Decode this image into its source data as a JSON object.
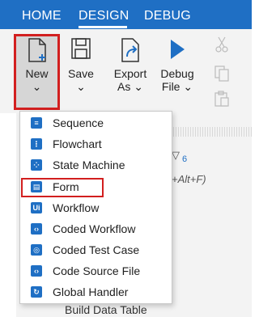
{
  "tabs": [
    "HOME",
    "DESIGN",
    "DEBUG"
  ],
  "ribbon": {
    "new": {
      "label": "New",
      "chevron": "⌄"
    },
    "save": {
      "label": "Save",
      "chevron": "⌄"
    },
    "export": {
      "label_line1": "Export",
      "label_line2": "As ⌄"
    },
    "debug": {
      "label_line1": "Debug",
      "label_line2": "File ⌄"
    }
  },
  "menu": {
    "items": [
      {
        "label": "Sequence",
        "icon": "sequence-icon"
      },
      {
        "label": "Flowchart",
        "icon": "flowchart-icon"
      },
      {
        "label": "State Machine",
        "icon": "state-machine-icon"
      },
      {
        "label": "Form",
        "icon": "form-icon"
      },
      {
        "label": "Workflow",
        "icon": "workflow-icon"
      },
      {
        "label": "Coded Workflow",
        "icon": "coded-workflow-icon"
      },
      {
        "label": "Coded Test Case",
        "icon": "coded-test-case-icon"
      },
      {
        "label": "Code Source File",
        "icon": "code-source-file-icon"
      },
      {
        "label": "Global Handler",
        "icon": "global-handler-icon"
      }
    ],
    "highlighted": "Form"
  },
  "background": {
    "filter_count": "6",
    "shortcut_text": "+Alt+F)",
    "peek_item": "Build Data Table"
  },
  "colors": {
    "accent": "#1f6fc4",
    "highlight": "#d21f1f"
  }
}
